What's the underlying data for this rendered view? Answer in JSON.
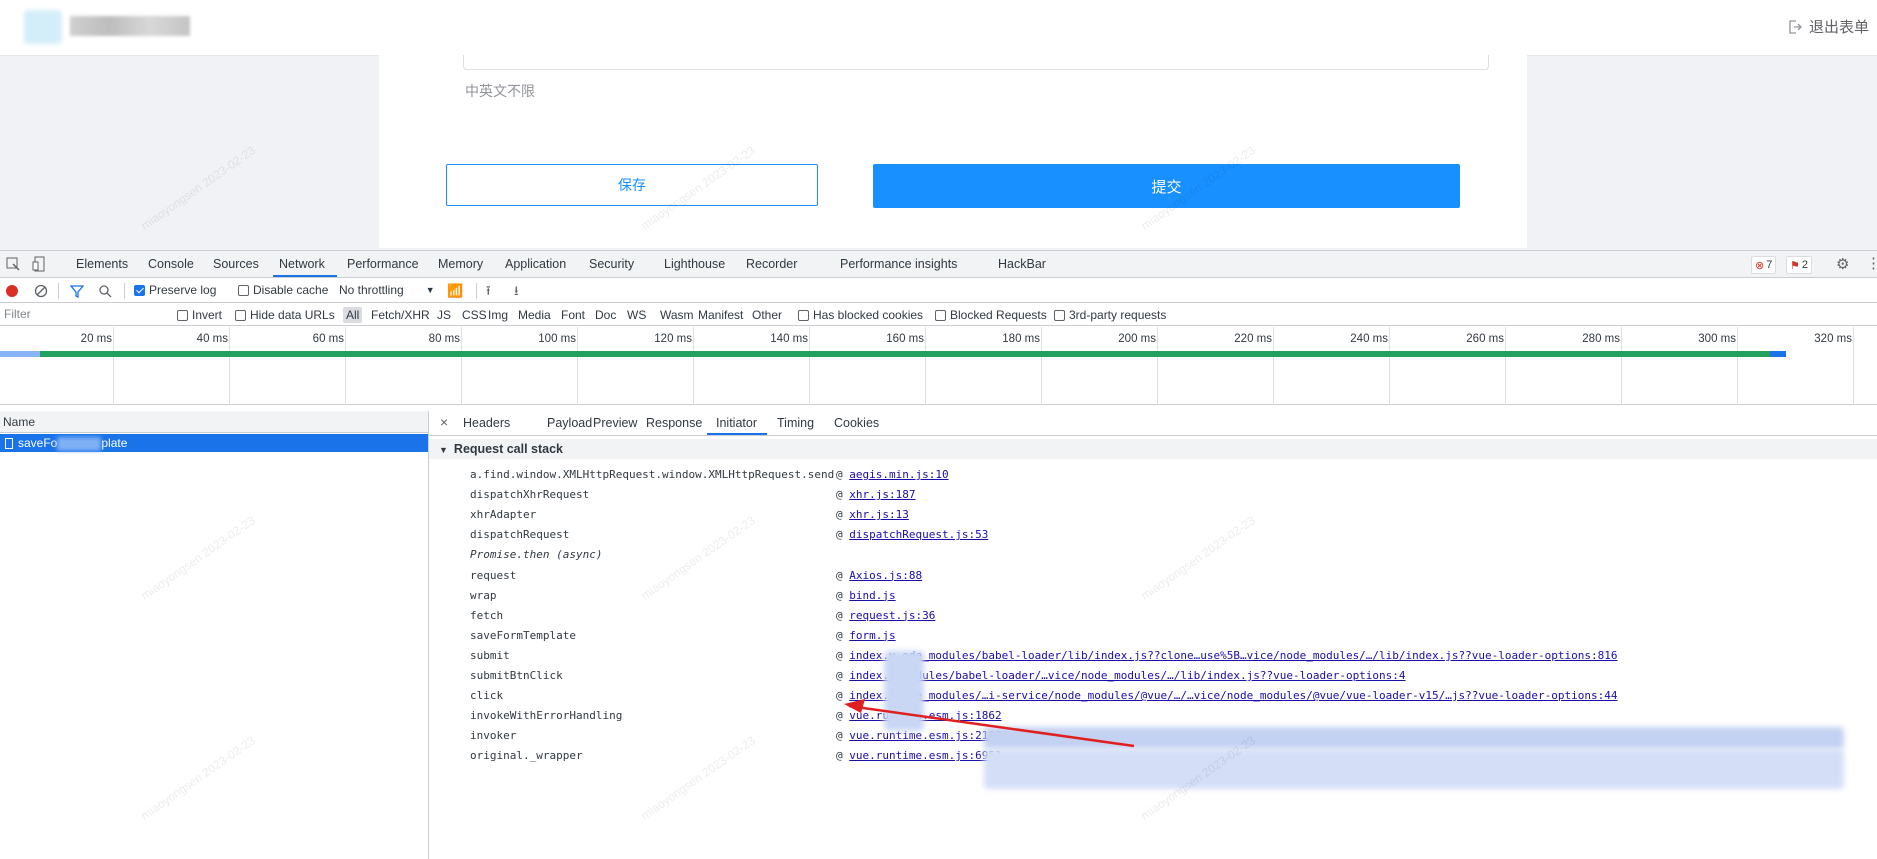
{
  "header": {
    "exit_label": "退出表单"
  },
  "form": {
    "hint": "中英文不限",
    "save_label": "保存",
    "submit_label": "提交"
  },
  "devtools": {
    "tabs": [
      "Elements",
      "Console",
      "Sources",
      "Network",
      "Performance",
      "Memory",
      "Application",
      "Security",
      "Lighthouse",
      "Recorder",
      "Performance insights",
      "HackBar"
    ],
    "error_count": "7",
    "issue_count": "2",
    "toolbar": {
      "preserve_log": "Preserve log",
      "disable_cache": "Disable cache",
      "throttling": "No throttling"
    },
    "filter": {
      "placeholder": "Filter",
      "invert": "Invert",
      "hide_data_urls": "Hide data URLs",
      "types": [
        "All",
        "Fetch/XHR",
        "JS",
        "CSS",
        "Img",
        "Media",
        "Font",
        "Doc",
        "WS",
        "Wasm",
        "Manifest",
        "Other"
      ],
      "has_blocked_cookies": "Has blocked cookies",
      "blocked_requests": "Blocked Requests",
      "third_party": "3rd-party requests"
    },
    "timeline_ticks": [
      "20 ms",
      "40 ms",
      "60 ms",
      "80 ms",
      "100 ms",
      "120 ms",
      "140 ms",
      "160 ms",
      "180 ms",
      "200 ms",
      "220 ms",
      "240 ms",
      "260 ms",
      "280 ms",
      "300 ms",
      "320 ms"
    ],
    "name_header": "Name",
    "request_name_prefix": "saveFo",
    "request_name_suffix": "plate",
    "detail_tabs": [
      "Headers",
      "Payload",
      "Preview",
      "Response",
      "Initiator",
      "Timing",
      "Cookies"
    ],
    "stack_title": "Request call stack",
    "stack": [
      {
        "fn": "a.find.window.XMLHttpRequest.window.XMLHttpRequest.send",
        "src": "aegis.min.js:10"
      },
      {
        "fn": "dispatchXhrRequest",
        "src": "xhr.js:187"
      },
      {
        "fn": "xhrAdapter",
        "src": "xhr.js:13"
      },
      {
        "fn": "dispatchRequest",
        "src": "dispatchRequest.js:53"
      },
      {
        "fn": "Promise.then (async)",
        "src": ""
      },
      {
        "fn": "request",
        "src": "Axios.js:88"
      },
      {
        "fn": "wrap",
        "src": "bind.js"
      },
      {
        "fn": "fetch",
        "src": "request.js:36"
      },
      {
        "fn": "saveFormTemplate",
        "src": "form.js"
      },
      {
        "fn": "submit",
        "src": "index.v…ode_modules/babel-loader/lib/index.js??clone…use%5B…vice/node_modules/…/lib/index.js??vue-loader-options:816"
      },
      {
        "fn": "submitBtnClick",
        "src": "index.v…modules/babel-loader/…vice/node_modules/…/lib/index.js??vue-loader-options:4"
      },
      {
        "fn": "click",
        "src": "index.v…ode_modules/…i-service/node_modules/@vue/…/…vice/node_modules/@vue/vue-loader-v15/…js??vue-loader-options:44"
      },
      {
        "fn": "invokeWithErrorHandling",
        "src": "vue.runtime.esm.js:1862"
      },
      {
        "fn": "invoker",
        "src": "vue.runtime.esm.js:2187"
      },
      {
        "fn": "original._wrapper",
        "src": "vue.runtime.esm.js:6951"
      }
    ],
    "watermark": "miaoyongsen 2023-02-23"
  }
}
